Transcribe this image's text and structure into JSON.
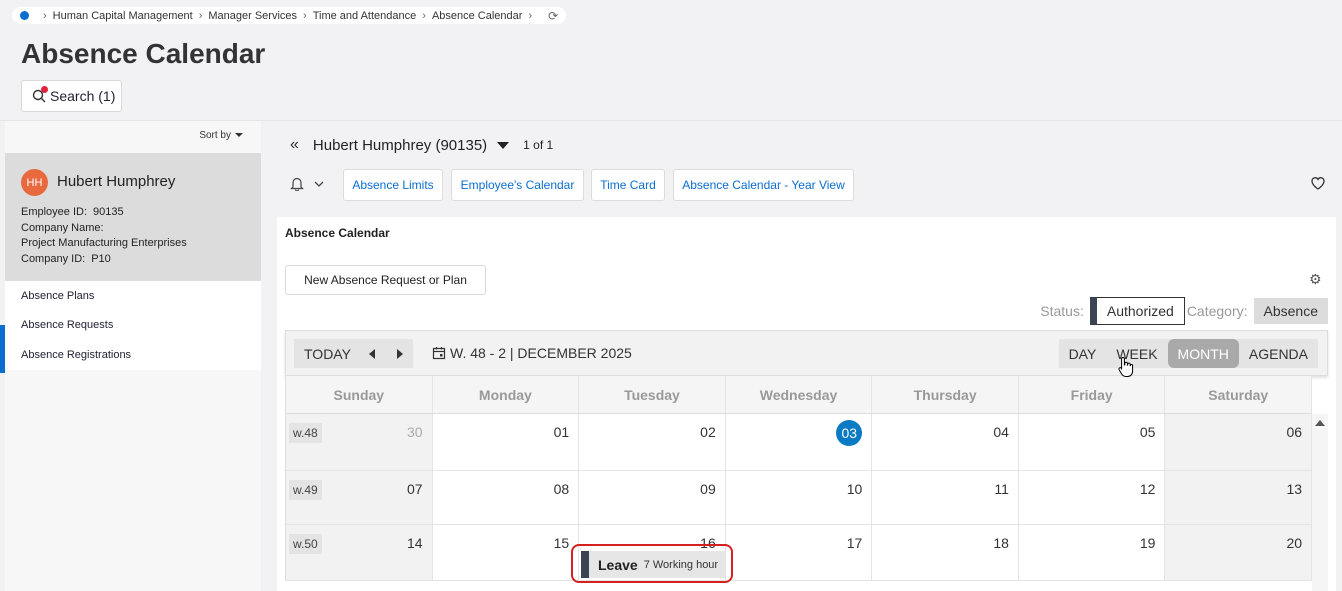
{
  "breadcrumb": {
    "items": [
      "Human Capital Management",
      "Manager Services",
      "Time and Attendance",
      "Absence Calendar"
    ]
  },
  "page": {
    "title": "Absence Calendar"
  },
  "search": {
    "label": "Search (1)"
  },
  "sidebar": {
    "sort_label": "Sort by",
    "employee": {
      "initials": "HH",
      "name": "Hubert Humphrey",
      "id_label": "Employee ID:",
      "id_value": "90135",
      "company_name_label": "Company Name:",
      "company_name_value": "Project Manufacturing Enterprises",
      "company_id_label": "Company ID:",
      "company_id_value": "P10"
    },
    "nav": [
      "Absence Plans",
      "Absence Requests",
      "Absence Registrations"
    ]
  },
  "employee_switch": {
    "name": "Hubert Humphrey (90135)",
    "count": "1 of 1"
  },
  "actions": [
    "Absence Limits",
    "Employee's Calendar",
    "Time Card",
    "Absence Calendar - Year View"
  ],
  "calendar": {
    "title": "Absence Calendar",
    "new_request_label": "New Absence Request or Plan",
    "status_label": "Status:",
    "status_value": "Authorized",
    "category_label": "Category:",
    "category_value": "Absence",
    "today_label": "TODAY",
    "date_label": "W. 48 - 2 | DECEMBER 2025",
    "views": [
      "DAY",
      "WEEK",
      "MONTH",
      "AGENDA"
    ],
    "active_view": "MONTH",
    "weekdays": [
      "Sunday",
      "Monday",
      "Tuesday",
      "Wednesday",
      "Thursday",
      "Friday",
      "Saturday"
    ],
    "weeks": [
      {
        "label": "w.48",
        "days": [
          "30",
          "01",
          "02",
          "03",
          "04",
          "05",
          "06"
        ]
      },
      {
        "label": "w.49",
        "days": [
          "07",
          "08",
          "09",
          "10",
          "11",
          "12",
          "13"
        ]
      },
      {
        "label": "w.50",
        "days": [
          "14",
          "15",
          "16",
          "17",
          "18",
          "19",
          "20"
        ]
      }
    ],
    "today_day": "03",
    "event": {
      "title": "Leave",
      "subtitle": "7 Working hour"
    }
  },
  "colors": {
    "accent": "#0a6ed1",
    "today": "#0a7ac5",
    "avatar": "#e9693e",
    "highlight": "#d62020"
  }
}
